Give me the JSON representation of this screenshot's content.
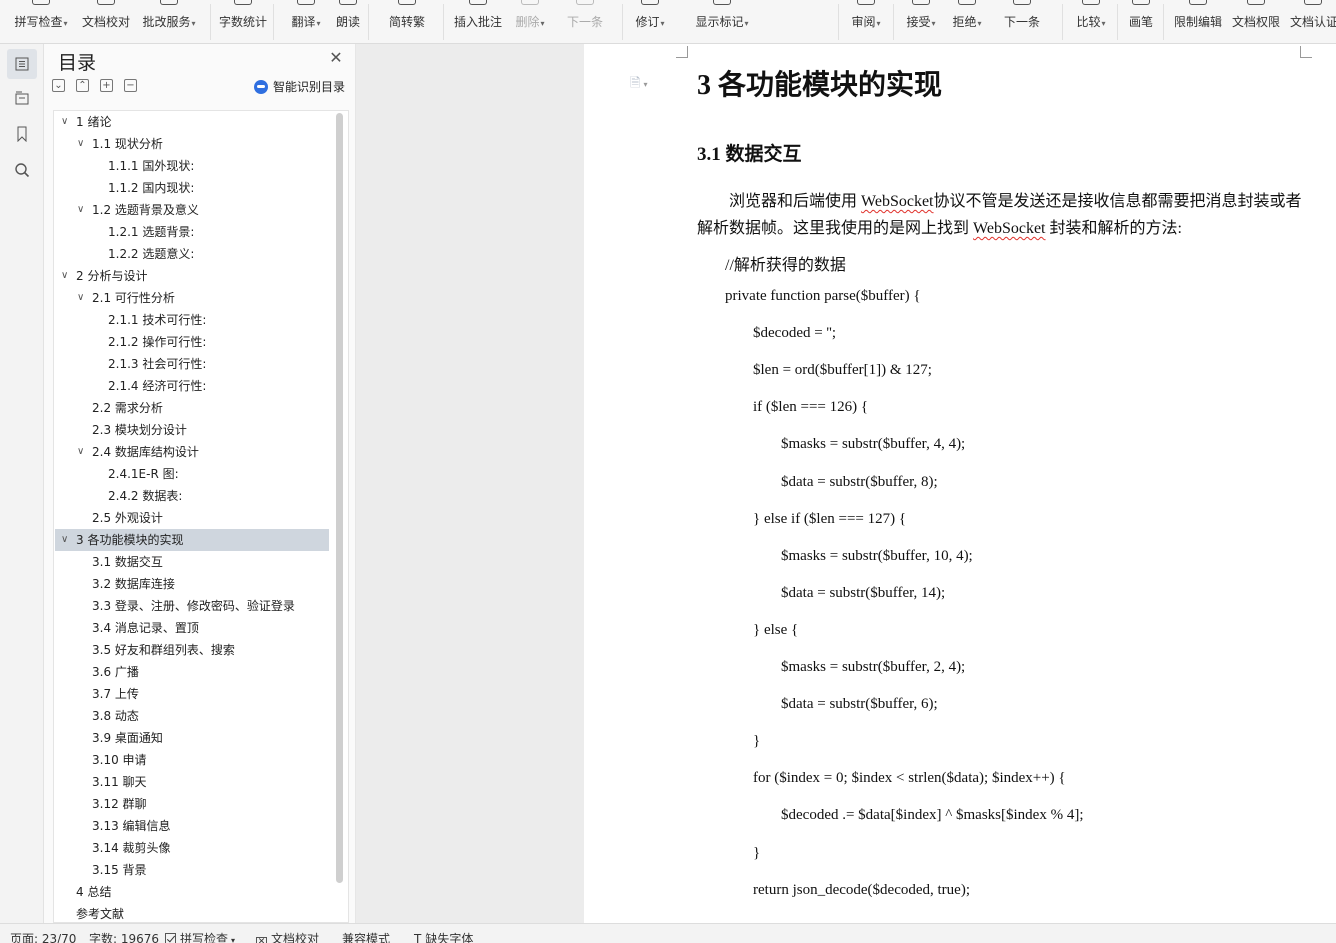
{
  "ribbon": {
    "items": [
      {
        "label": "拼写检查",
        "dropdown": true,
        "icon": "spellcheck-icon"
      },
      {
        "label": "文档校对",
        "dropdown": false,
        "icon": "proofread-icon"
      },
      {
        "label": "批改服务",
        "dropdown": true,
        "icon": "correction-service-icon"
      },
      {
        "label": "字数统计",
        "dropdown": false,
        "icon": "word-count-icon"
      },
      {
        "label": "翻译",
        "dropdown": true,
        "icon": "translate-icon"
      },
      {
        "label": "朗读",
        "dropdown": false,
        "icon": "read-aloud-icon"
      },
      {
        "label": "简转繁",
        "dropdown": false,
        "icon": "simplified-traditional-icon"
      },
      {
        "label": "插入批注",
        "dropdown": false,
        "icon": "insert-comment-icon"
      },
      {
        "label": "删除",
        "dropdown": true,
        "icon": "delete-comment-icon",
        "disabled": true
      },
      {
        "label": "下一条",
        "dropdown": false,
        "icon": "next-comment-icon",
        "disabled": true
      },
      {
        "label": "修订",
        "dropdown": true,
        "icon": "track-changes-icon"
      },
      {
        "label": "显示标记",
        "dropdown": true,
        "icon": "show-markup-icon"
      },
      {
        "label": "审阅",
        "dropdown": true,
        "icon": "review-pane-icon"
      },
      {
        "label": "接受",
        "dropdown": true,
        "icon": "accept-icon"
      },
      {
        "label": "拒绝",
        "dropdown": true,
        "icon": "reject-icon"
      },
      {
        "label": "下一条",
        "dropdown": false,
        "icon": "next-change-icon"
      },
      {
        "label": "比较",
        "dropdown": true,
        "icon": "compare-icon"
      },
      {
        "label": "画笔",
        "dropdown": false,
        "icon": "pen-icon"
      },
      {
        "label": "限制编辑",
        "dropdown": false,
        "icon": "restrict-editing-icon"
      },
      {
        "label": "文档权限",
        "dropdown": false,
        "icon": "document-permission-icon"
      },
      {
        "label": "文档认证",
        "dropdown": false,
        "icon": "document-certification-icon"
      }
    ]
  },
  "nav": {
    "title": "目录",
    "smart_toc_label": "智能识别目录",
    "items": [
      {
        "label": "1 绪论",
        "level": 1,
        "expanded": true
      },
      {
        "label": "1.1 现状分析",
        "level": 2,
        "expanded": true
      },
      {
        "label": "1.1.1 国外现状:",
        "level": 3
      },
      {
        "label": "1.1.2 国内现状:",
        "level": 3
      },
      {
        "label": "1.2 选题背景及意义",
        "level": 2,
        "expanded": true
      },
      {
        "label": "1.2.1 选题背景:",
        "level": 3
      },
      {
        "label": "1.2.2 选题意义:",
        "level": 3
      },
      {
        "label": "2 分析与设计",
        "level": 1,
        "expanded": true
      },
      {
        "label": "2.1 可行性分析",
        "level": 2,
        "expanded": true
      },
      {
        "label": "2.1.1 技术可行性:",
        "level": 3
      },
      {
        "label": "2.1.2 操作可行性:",
        "level": 3
      },
      {
        "label": "2.1.3 社会可行性:",
        "level": 3
      },
      {
        "label": "2.1.4 经济可行性:",
        "level": 3
      },
      {
        "label": "2.2 需求分析",
        "level": 2
      },
      {
        "label": "2.3 模块划分设计",
        "level": 2
      },
      {
        "label": "2.4 数据库结构设计",
        "level": 2,
        "expanded": true
      },
      {
        "label": "2.4.1E-R 图:",
        "level": 3
      },
      {
        "label": "2.4.2 数据表:",
        "level": 3
      },
      {
        "label": "2.5 外观设计",
        "level": 2
      },
      {
        "label": "3 各功能模块的实现",
        "level": 1,
        "expanded": true,
        "selected": true
      },
      {
        "label": "3.1 数据交互",
        "level": 2
      },
      {
        "label": "3.2 数据库连接",
        "level": 2
      },
      {
        "label": "3.3 登录、注册、修改密码、验证登录",
        "level": 2
      },
      {
        "label": "3.4 消息记录、置顶",
        "level": 2
      },
      {
        "label": "3.5 好友和群组列表、搜索",
        "level": 2
      },
      {
        "label": "3.6 广播",
        "level": 2
      },
      {
        "label": "3.7 上传",
        "level": 2
      },
      {
        "label": "3.8 动态",
        "level": 2
      },
      {
        "label": "3.9 桌面通知",
        "level": 2
      },
      {
        "label": "3.10 申请",
        "level": 2
      },
      {
        "label": "3.11 聊天",
        "level": 2
      },
      {
        "label": "3.12 群聊",
        "level": 2
      },
      {
        "label": "3.13 编辑信息",
        "level": 2
      },
      {
        "label": "3.14 裁剪头像",
        "level": 2
      },
      {
        "label": "3.15 背景",
        "level": 2
      },
      {
        "label": "4 总结",
        "level": 1
      },
      {
        "label": "参考文献",
        "level": 1
      }
    ]
  },
  "document": {
    "heading1": "3 各功能模块的实现",
    "heading2": "3.1 数据交互",
    "para_line1_a": "浏览器和后端使用 ",
    "para_line1_b": "WebSocket",
    "para_line1_c": "协议不管是发送还是接收信息都需要把消息封装或者",
    "para_line2_a": "解析数据帧。这里我使用的是网上找到 ",
    "para_line2_b": "WebSocket",
    "para_line2_c": " 封装和解析的方法:",
    "code_comment": "//解析获得的数据",
    "code_lines": [
      {
        "indent": 0,
        "text": "private function parse($buffer) {"
      },
      {
        "indent": 1,
        "text": "$decoded = '';"
      },
      {
        "indent": 1,
        "text": "$len = ord($buffer[1]) & 127;"
      },
      {
        "indent": 1,
        "text": "if ($len === 126) {"
      },
      {
        "indent": 2,
        "text": "$masks = substr($buffer, 4, 4);"
      },
      {
        "indent": 2,
        "text": "$data = substr($buffer, 8);"
      },
      {
        "indent": 1,
        "text": "} else if ($len === 127) {"
      },
      {
        "indent": 2,
        "text": "$masks = substr($buffer, 10, 4);"
      },
      {
        "indent": 2,
        "text": "$data = substr($buffer, 14);"
      },
      {
        "indent": 1,
        "text": "} else {"
      },
      {
        "indent": 2,
        "text": "$masks = substr($buffer, 2, 4);"
      },
      {
        "indent": 2,
        "text": "$data = substr($buffer, 6);"
      },
      {
        "indent": 1,
        "text": "}"
      },
      {
        "indent": 1,
        "text": "for ($index = 0; $index < strlen($data); $index++) {"
      },
      {
        "indent": 2,
        "text": "$decoded .= $data[$index] ^ $masks[$index % 4];"
      },
      {
        "indent": 1,
        "text": "}"
      },
      {
        "indent": 1,
        "text": "return json_decode($decoded, true);"
      }
    ]
  },
  "status": {
    "page": "页面: 23/70",
    "word_count": "字数: 19676",
    "spellcheck": "拼写检查",
    "proofread": "文档校对",
    "compat_mode": "兼容模式",
    "missing_fonts": "缺失字体"
  },
  "colors": {
    "selected_row": "#cfd6de",
    "squiggle": "#e0302a",
    "smart_toc_icon": "#2f6fe0"
  }
}
